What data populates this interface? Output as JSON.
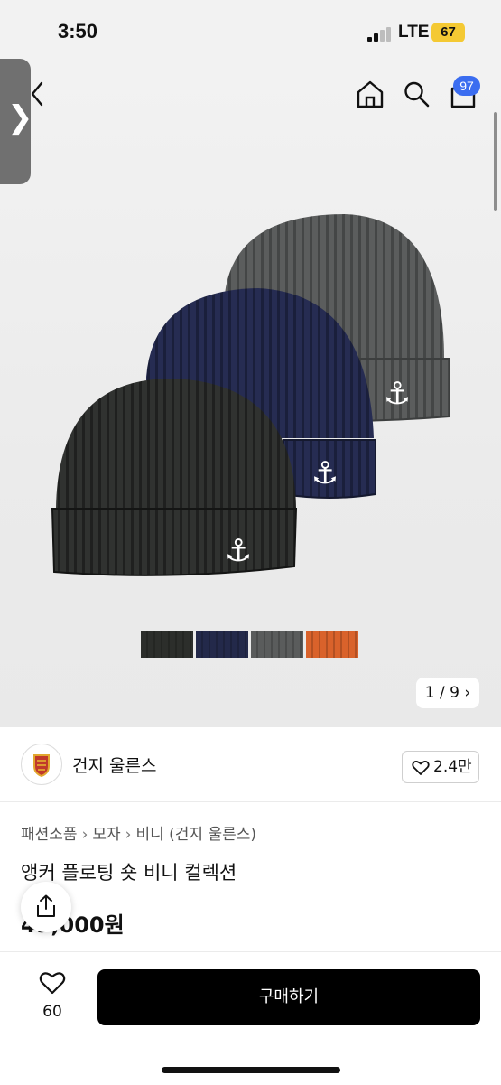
{
  "status_bar": {
    "time": "3:50",
    "network": "LTE",
    "battery": "67"
  },
  "header": {
    "cart_badge": "97"
  },
  "gallery": {
    "counter": "1 / 9",
    "swatch_colors": [
      "#2c2e2b",
      "#23294a",
      "#5a5c5c",
      "#d9622b"
    ]
  },
  "brand": {
    "name": "건지 울른스",
    "likes": "2.4만"
  },
  "breadcrumb": [
    "패션소품",
    "모자",
    "비니 (건지 울른스)"
  ],
  "product": {
    "title": "앵커 플로팅 숏 비니 컬렉션",
    "price": "49,000원"
  },
  "bottom_bar": {
    "wish_count": "60",
    "buy_label": "구매하기"
  }
}
